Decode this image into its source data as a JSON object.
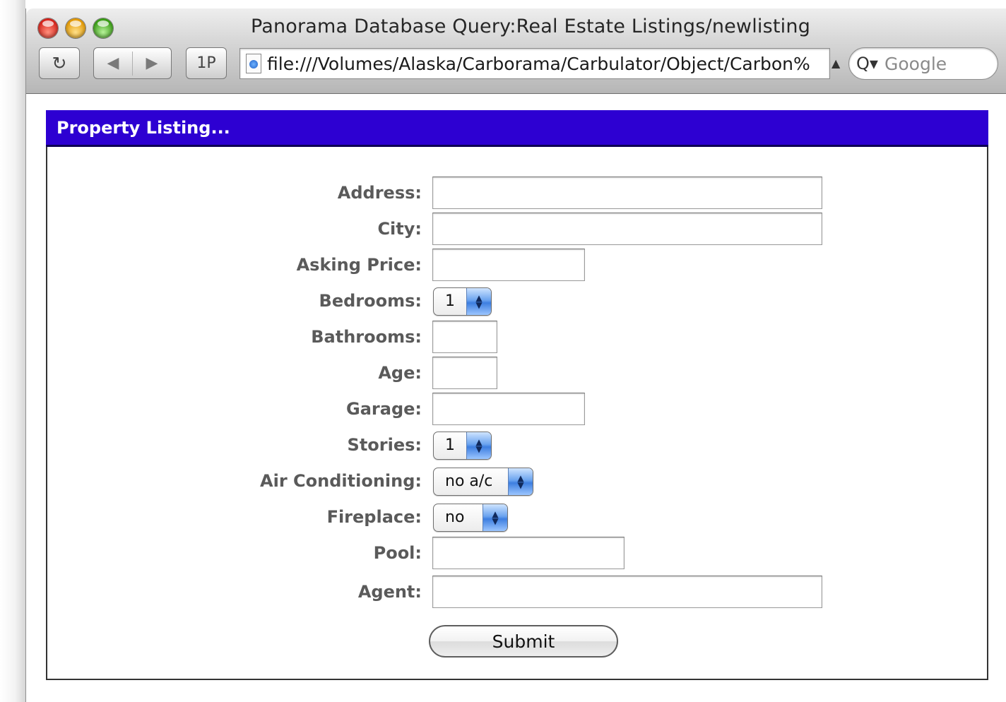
{
  "window": {
    "title": "Panorama Database Query:Real Estate Listings/newlisting"
  },
  "toolbar": {
    "reload_icon": "reload-icon",
    "back_icon": "back-arrow-icon",
    "forward_icon": "forward-arrow-icon",
    "onepassword_label": "1P",
    "url": "file:///Volumes/Alaska/Carborama/Carbulator/Object/Carbon%",
    "search_placeholder": "Google"
  },
  "form": {
    "header": "Property Listing...",
    "fields": {
      "address": {
        "label": "Address:",
        "value": ""
      },
      "city": {
        "label": "City:",
        "value": ""
      },
      "asking_price": {
        "label": "Asking Price:",
        "value": ""
      },
      "bedrooms": {
        "label": "Bedrooms:",
        "selected": "1"
      },
      "bathrooms": {
        "label": "Bathrooms:",
        "value": ""
      },
      "age": {
        "label": "Age:",
        "value": ""
      },
      "garage": {
        "label": "Garage:",
        "value": ""
      },
      "stories": {
        "label": "Stories:",
        "selected": "1"
      },
      "air_conditioning": {
        "label": "Air Conditioning:",
        "selected": "no a/c"
      },
      "fireplace": {
        "label": "Fireplace:",
        "selected": "no"
      },
      "pool": {
        "label": "Pool:",
        "value": ""
      },
      "agent": {
        "label": "Agent:",
        "value": ""
      }
    },
    "submit_label": "Submit"
  },
  "colors": {
    "header_bg": "#2d00d2",
    "label_text": "#5a5a5a"
  }
}
